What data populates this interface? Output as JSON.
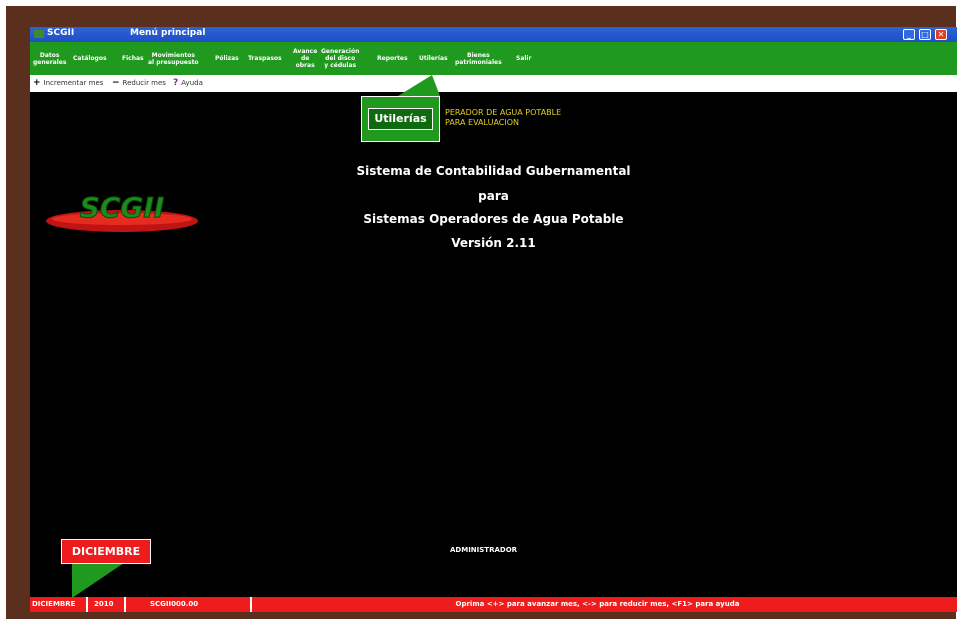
{
  "window": {
    "app_name": "SCGII",
    "title": "Menú principal",
    "minimize_label": "_",
    "maximize_label": "□",
    "close_label": "✕"
  },
  "menu": {
    "items": [
      {
        "label": "Datos\ngenerales"
      },
      {
        "label": "Catálogos"
      },
      {
        "label": "Fichas"
      },
      {
        "label": "Movimientos\nal presupuesto"
      },
      {
        "label": "Pólizas"
      },
      {
        "label": "Traspasos"
      },
      {
        "label": "Avance\nde\nobras"
      },
      {
        "label": "Generación\ndel disco\ny cédulas"
      },
      {
        "label": "Reportes"
      },
      {
        "label": "Utilerías"
      },
      {
        "label": "Bienes\npatrimoniales"
      },
      {
        "label": "Salir"
      }
    ]
  },
  "toolbar": {
    "increment": {
      "icon": "+",
      "label": "Incrementar mes"
    },
    "reduce": {
      "icon": "−",
      "label": "Reducir mes"
    },
    "help": {
      "icon": "?",
      "label": "Ayuda"
    }
  },
  "header_info": {
    "line1": "PERADOR DE AGUA POTABLE",
    "line2": "PARA EVALUACION"
  },
  "main": {
    "line1": "Sistema de Contabilidad Gubernamental",
    "line2": "para",
    "line3": "Sistemas Operadores de Agua Potable",
    "version": "Versión 2.11",
    "logo_text": "SCGII",
    "user": "ADMINISTRADOR"
  },
  "status_bar": {
    "month": "DICIEMBRE",
    "year": "2010",
    "module": "SCGII000.00",
    "hint": "Oprima <+> para avanzar mes, <-> para reducir mes, <F1> para ayuda"
  },
  "callouts": {
    "utilerias": "Utilerías",
    "diciembre": "DICIEMBRE"
  },
  "colors": {
    "menu_bg": "#1f9a1f",
    "status_bg": "#ee1c1c",
    "title_bg": "#2c64d8",
    "info_text": "#e0d020"
  }
}
